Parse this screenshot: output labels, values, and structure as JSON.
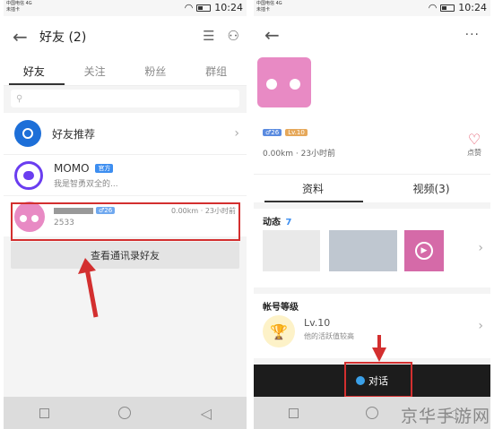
{
  "status": {
    "carrier_line1": "中国电信 4G",
    "carrier_line2": "未插卡",
    "time": "10:24"
  },
  "left": {
    "title": "好友 (2)",
    "tabs": [
      "好友",
      "关注",
      "粉丝",
      "群组"
    ],
    "rows": {
      "recommend": {
        "label": "好友推荐"
      },
      "momo": {
        "name": "MOMO",
        "badge": "官方",
        "sub": "我是智勇双全的..."
      },
      "friend": {
        "badge": "♂26",
        "meta": "0.00km · 23小时前",
        "sub": "2533"
      }
    },
    "contacts_button": "查看通讯录好友"
  },
  "right": {
    "badges": {
      "age": "♂26",
      "level": "Lv.10"
    },
    "meta": "0.00km · 23小时前",
    "like_label": "点赞",
    "tabs": [
      "资料",
      "视频(3)"
    ],
    "feed_title": "动态",
    "feed_count": "7",
    "account_title": "帐号等级",
    "level": "Lv.10",
    "level_sub": "他的活跃值较高",
    "chat_label": "对话"
  },
  "watermark": "京华手游网",
  "colors": {
    "accent_red": "#d32f2f",
    "badge_blue": "#3d8ef0",
    "momo_purple": "#6a3df0"
  }
}
